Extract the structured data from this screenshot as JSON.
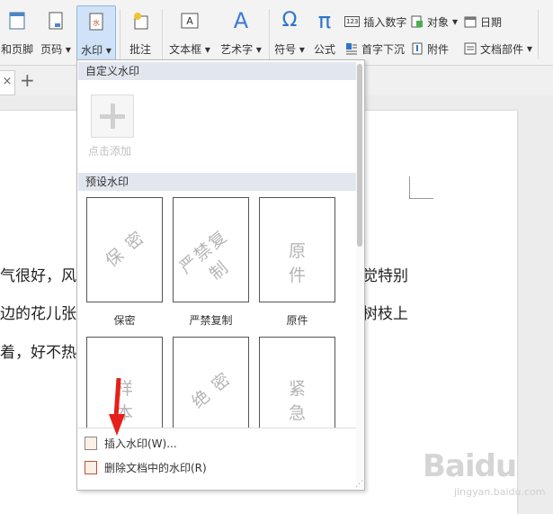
{
  "ribbon": {
    "header_footer": "和页脚",
    "page_number": "页码",
    "watermark": "水印",
    "comment": "批注",
    "textbox": "文本框",
    "wordart": "艺术字",
    "symbol": "符号",
    "formula": "公式",
    "insert_number": "插入数字",
    "object": "对象",
    "date": "日期",
    "drop_cap": "首字下沉",
    "attachment": "附件",
    "doc_parts": "文档部件",
    "dropdown_mark": "▾",
    "omega": "Ω",
    "pi": "π",
    "text_a": "A",
    "num_icon": "123"
  },
  "tabbar": {
    "close": "×",
    "add": "+"
  },
  "document": {
    "line1": "气很好，风",
    "line1_right": "觉特别",
    "line2": "边的花儿张",
    "line2_right": "树枝上",
    "line3": "着，好不热"
  },
  "panel": {
    "custom_header": "自定义水印",
    "add_label": "点击添加",
    "preset_header": "预设水印",
    "presets": [
      {
        "label": "保密",
        "text": "保 密"
      },
      {
        "label": "严禁复制",
        "text": "严禁复制"
      },
      {
        "label": "原件",
        "text": "原 件"
      },
      {
        "label": "",
        "text": "样 本"
      },
      {
        "label": "",
        "text": "绝 密"
      },
      {
        "label": "",
        "text": "紧 急"
      }
    ],
    "insert_watermark": "插入水印(W)...",
    "remove_watermark": "删除文档中的水印(R)"
  },
  "watermark_logo": {
    "text": "Baidu",
    "sub": "jingyan.baidu.com"
  },
  "colors": {
    "accent": "#2e75c8",
    "arrow": "#e52019",
    "panel_header_bg": "#e2e6ee"
  }
}
